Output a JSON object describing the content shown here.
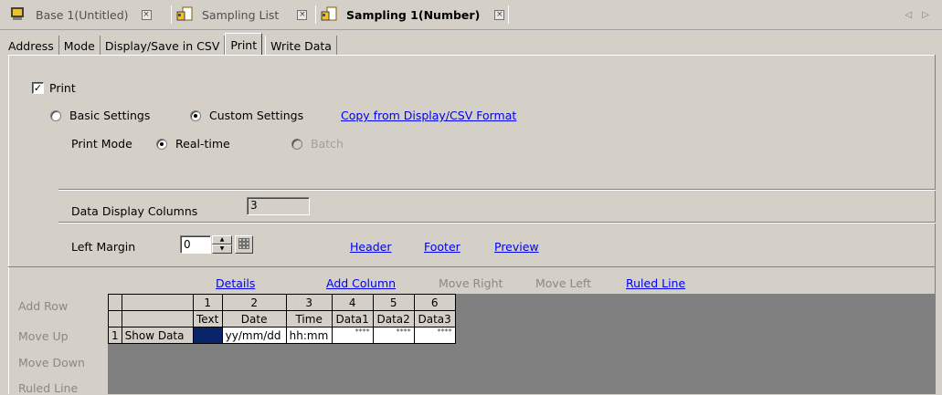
{
  "doc_tabs": [
    {
      "label": "Base 1(Untitled)",
      "icon": "screen-icon"
    },
    {
      "label": "Sampling List",
      "icon": "sampling-icon"
    },
    {
      "label": "Sampling 1(Number)",
      "icon": "sampling-icon",
      "active": true
    }
  ],
  "nav_arrows": "◁ ▷",
  "sub_tabs": [
    "Address",
    "Mode",
    "Display/Save in CSV",
    "Print",
    "Write Data"
  ],
  "print": {
    "checkbox_label": "Print",
    "checked": true,
    "basic_settings": "Basic Settings",
    "custom_settings": "Custom Settings",
    "copy_link": "Copy from Display/CSV Format",
    "print_mode_label": "Print Mode",
    "realtime": "Real-time",
    "batch": "Batch",
    "data_display_columns_label": "Data Display Columns",
    "data_display_columns_value": "3",
    "left_margin_label": "Left Margin",
    "left_margin_value": "0",
    "header_link": "Header",
    "footer_link": "Footer",
    "preview_link": "Preview"
  },
  "grid_toolbar": {
    "details": "Details",
    "add_column": "Add Column",
    "move_right": "Move Right",
    "move_left": "Move Left",
    "ruled_line": "Ruled Line"
  },
  "side_buttons": {
    "add_row": "Add Row",
    "move_up": "Move Up",
    "move_down": "Move Down",
    "ruled_line": "Ruled Line"
  },
  "grid": {
    "col_numbers": [
      "1",
      "2",
      "3",
      "4",
      "5",
      "6"
    ],
    "col_headers": [
      "Text",
      "Date",
      "Time",
      "Data1",
      "Data2",
      "Data3"
    ],
    "row_number": "1",
    "row_label": "Show Data",
    "row_values": [
      "",
      "yy/mm/dd",
      "hh:mm",
      "****",
      "****",
      "****"
    ]
  }
}
